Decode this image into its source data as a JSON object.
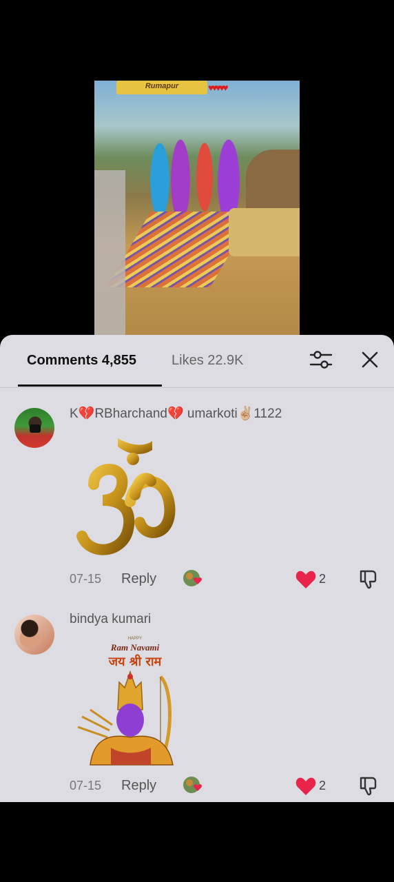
{
  "video": {
    "banner_text": "Rumapur"
  },
  "tabs": {
    "comments_label": "Comments 4,855",
    "likes_label": "Likes 22.9K"
  },
  "icons": {
    "filter": "sliders-icon",
    "close": "close-icon",
    "like": "heart-icon",
    "dislike": "thumbs-down-icon"
  },
  "colors": {
    "panel_bg": "#dcdce2",
    "heart": "#e8244a",
    "om_gold": "#c9951c",
    "ram_skin": "#8e3fd1"
  },
  "comments": [
    {
      "username": "K💔RBharchand💔 umarkoti✌🏼1122",
      "sticker": "om-symbol-sticker",
      "date": "07-15",
      "reply_label": "Reply",
      "likes": "2"
    },
    {
      "username": "bindya kumari",
      "sticker_text": {
        "happy": "HAPPY",
        "title": "Ram Navami",
        "hindi": "जय श्री राम"
      },
      "date": "07-15",
      "reply_label": "Reply",
      "likes": "2"
    }
  ]
}
